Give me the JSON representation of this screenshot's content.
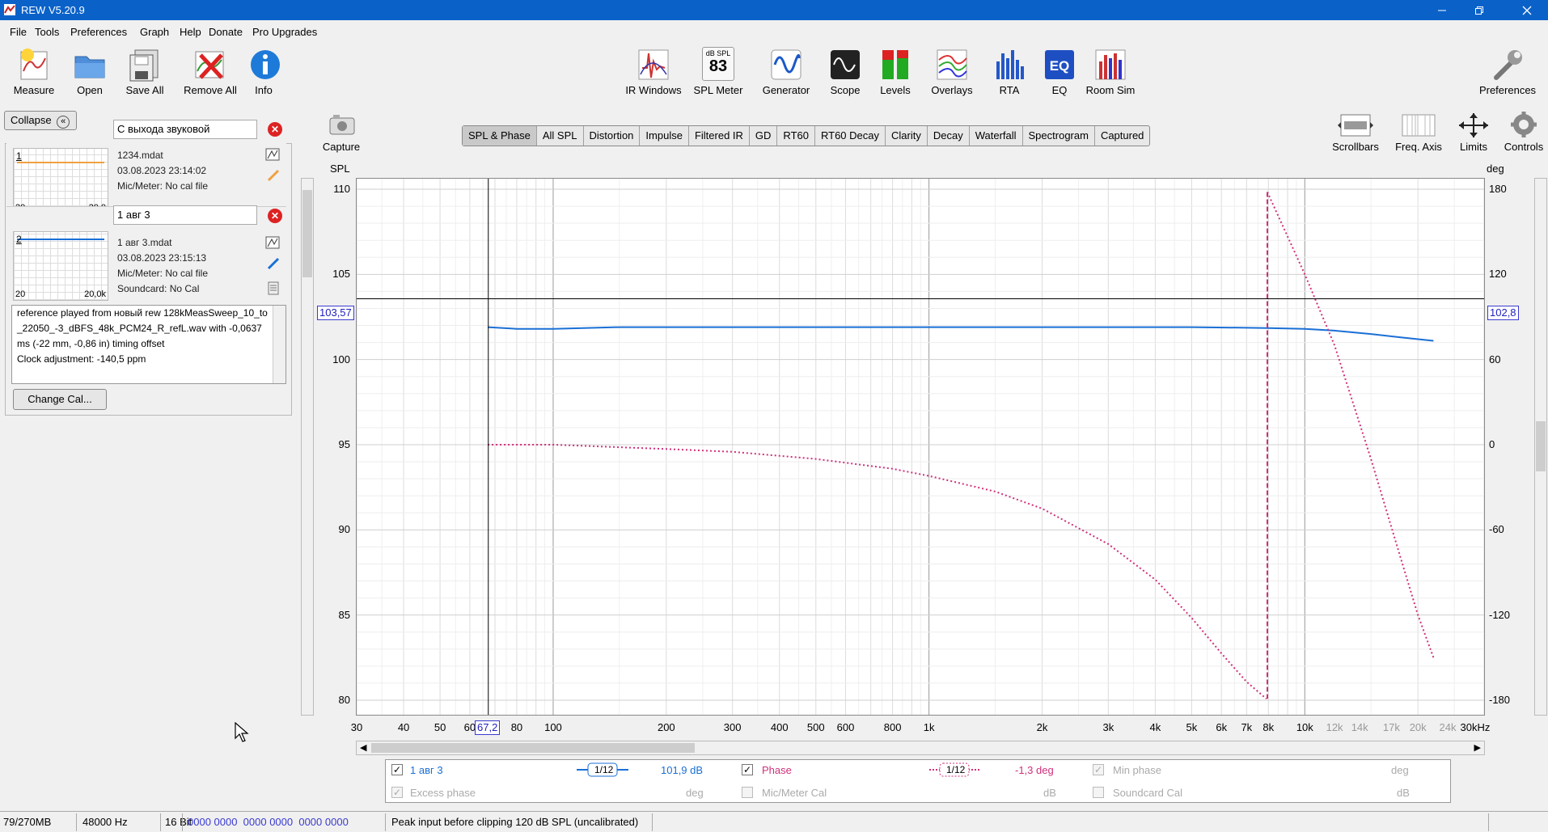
{
  "window": {
    "title": "REW V5.20.9"
  },
  "menu": [
    "File",
    "Tools",
    "Preferences",
    "Graph",
    "Help",
    "Donate",
    "Pro Upgrades"
  ],
  "toolbar_left": [
    {
      "label": "Measure",
      "icon": "measure-icon"
    },
    {
      "label": "Open",
      "icon": "folder-icon"
    },
    {
      "label": "Save All",
      "icon": "save-all-icon"
    },
    {
      "label": "Remove All",
      "icon": "remove-all-icon"
    },
    {
      "label": "Info",
      "icon": "info-icon"
    }
  ],
  "toolbar_center": [
    {
      "label": "IR Windows",
      "icon": "ir-windows-icon"
    },
    {
      "label": "SPL Meter",
      "icon": "spl-meter-icon",
      "badge_top": "dB SPL",
      "badge_value": "83"
    },
    {
      "label": "Generator",
      "icon": "generator-icon"
    },
    {
      "label": "Scope",
      "icon": "scope-icon"
    },
    {
      "label": "Levels",
      "icon": "levels-icon"
    },
    {
      "label": "Overlays",
      "icon": "overlays-icon"
    },
    {
      "label": "RTA",
      "icon": "rta-icon"
    },
    {
      "label": "EQ",
      "icon": "eq-icon"
    },
    {
      "label": "Room Sim",
      "icon": "room-sim-icon"
    }
  ],
  "toolbar_right": {
    "label": "Preferences",
    "icon": "wrench-icon"
  },
  "graph_tools": [
    {
      "label": "Capture",
      "icon": "camera-icon"
    },
    {
      "label": "Scrollbars",
      "icon": "scrollbars-icon"
    },
    {
      "label": "Freq. Axis",
      "icon": "freq-axis-icon"
    },
    {
      "label": "Limits",
      "icon": "limits-icon"
    },
    {
      "label": "Controls",
      "icon": "gear-icon"
    }
  ],
  "tabs": [
    "SPL & Phase",
    "All SPL",
    "Distortion",
    "Impulse",
    "Filtered IR",
    "GD",
    "RT60",
    "RT60 Decay",
    "Clarity",
    "Decay",
    "Waterfall",
    "Spectrogram",
    "Captured"
  ],
  "active_tab": "SPL & Phase",
  "collapse_label": "Collapse",
  "measurements": [
    {
      "num": "1",
      "name": "С выхода звуковой",
      "file": "1234.mdat",
      "date": "03.08.2023 23:14:02",
      "mic": "Mic/Meter: No cal file",
      "color": "#f0a040",
      "tick_lo": "20",
      "tick_hi": "20,0"
    },
    {
      "num": "2",
      "name": "1 авг 3",
      "file": "1 авг 3.mdat",
      "date": "03.08.2023 23:15:13",
      "mic": "Mic/Meter: No cal file",
      "soundcard": "Soundcard: No Cal",
      "color": "#1a6fd6",
      "tick_lo": "20",
      "tick_hi": "20,0k"
    }
  ],
  "notes": "reference played from новый rew 128kMeasSweep_10_to_22050_-3_dBFS_48k_PCM24_R_refL.wav with -0,0637 ms (-22 mm, -0,86 in) timing offset\nClock adjustment: -140,5 ppm",
  "change_cal_label": "Change Cal...",
  "graph": {
    "left_axis_title": "SPL",
    "right_axis_title": "deg",
    "y_left_ticks": [
      "110",
      "105",
      "100",
      "95",
      "90",
      "85",
      "80"
    ],
    "y_right_ticks": [
      "180",
      "120",
      "60",
      "0",
      "-60",
      "-120",
      "-180"
    ],
    "x_ticks_major": [
      "30",
      "40",
      "50",
      "60",
      "80",
      "100",
      "200",
      "300",
      "400",
      "500",
      "600",
      "800",
      "1k",
      "2k",
      "3k",
      "4k",
      "5k",
      "6k",
      "7k",
      "8k",
      "10k"
    ],
    "x_ticks_minor": [
      "12k",
      "14k",
      "17k",
      "20k",
      "24k"
    ],
    "x_ticks_tail": "30kHz",
    "cursor_left": "103,57",
    "cursor_right": "102,8",
    "cursor_freq": "67,2"
  },
  "chart_data": {
    "type": "line",
    "title": "",
    "xlabel": "",
    "ylabel": "SPL",
    "ylabel_right": "deg",
    "x_scale": "log",
    "xlim": [
      30,
      30000
    ],
    "ylim": [
      80,
      112
    ],
    "ylim_right": [
      -180,
      180
    ],
    "series": [
      {
        "name": "1 авг 3",
        "axis": "left",
        "color": "#1a6fd6",
        "style": "solid",
        "x": [
          67,
          80,
          100,
          150,
          200,
          300,
          500,
          1000,
          2000,
          5000,
          8000,
          10000,
          12000,
          15000,
          18000,
          22000
        ],
        "y": [
          101.9,
          101.8,
          101.8,
          101.9,
          101.9,
          101.9,
          101.9,
          101.9,
          101.9,
          101.9,
          101.85,
          101.8,
          101.7,
          101.5,
          101.3,
          101.1
        ]
      },
      {
        "name": "Phase",
        "axis": "right",
        "color": "#d0307a",
        "style": "dotted",
        "x": [
          67,
          100,
          200,
          300,
          500,
          800,
          1000,
          1500,
          2000,
          3000,
          4000,
          5000,
          6000,
          7000,
          7900,
          7950,
          10000,
          12000,
          15000,
          18000,
          20000,
          22000
        ],
        "y": [
          0,
          0,
          -3,
          -5,
          -10,
          -17,
          -22,
          -33,
          -45,
          -70,
          -95,
          -122,
          -147,
          -167,
          -179,
          178,
          120,
          70,
          -10,
          -80,
          -120,
          -150
        ]
      }
    ],
    "cursor": {
      "freq": 67.2,
      "spl": 103.57,
      "deg": 102.8
    }
  },
  "legend": {
    "row1": [
      {
        "label": "1 авг 3",
        "checked": true,
        "smoothing": "1/12",
        "value": "101,9 dB",
        "color": "#1a6fd6"
      },
      {
        "label": "Phase",
        "checked": true,
        "smoothing": "1/12",
        "value": "-1,3 deg",
        "color": "#d0307a"
      },
      {
        "label": "Min phase",
        "checked": false,
        "value": "deg",
        "disabled": true
      }
    ],
    "row2": [
      {
        "label": "Excess phase",
        "checked": false,
        "value": "deg",
        "disabled": true
      },
      {
        "label": "Mic/Meter Cal",
        "checked": false,
        "value": "dB",
        "disabled": true
      },
      {
        "label": "Soundcard Cal",
        "checked": false,
        "value": "dB",
        "disabled": true
      }
    ]
  },
  "status": {
    "memory": "79/270MB",
    "rate": "48000 Hz",
    "bits": "16 Bit",
    "hex": "0000 0000  0000 0000  0000 0000",
    "message": "Peak input before clipping 120 dB SPL (uncalibrated)"
  }
}
